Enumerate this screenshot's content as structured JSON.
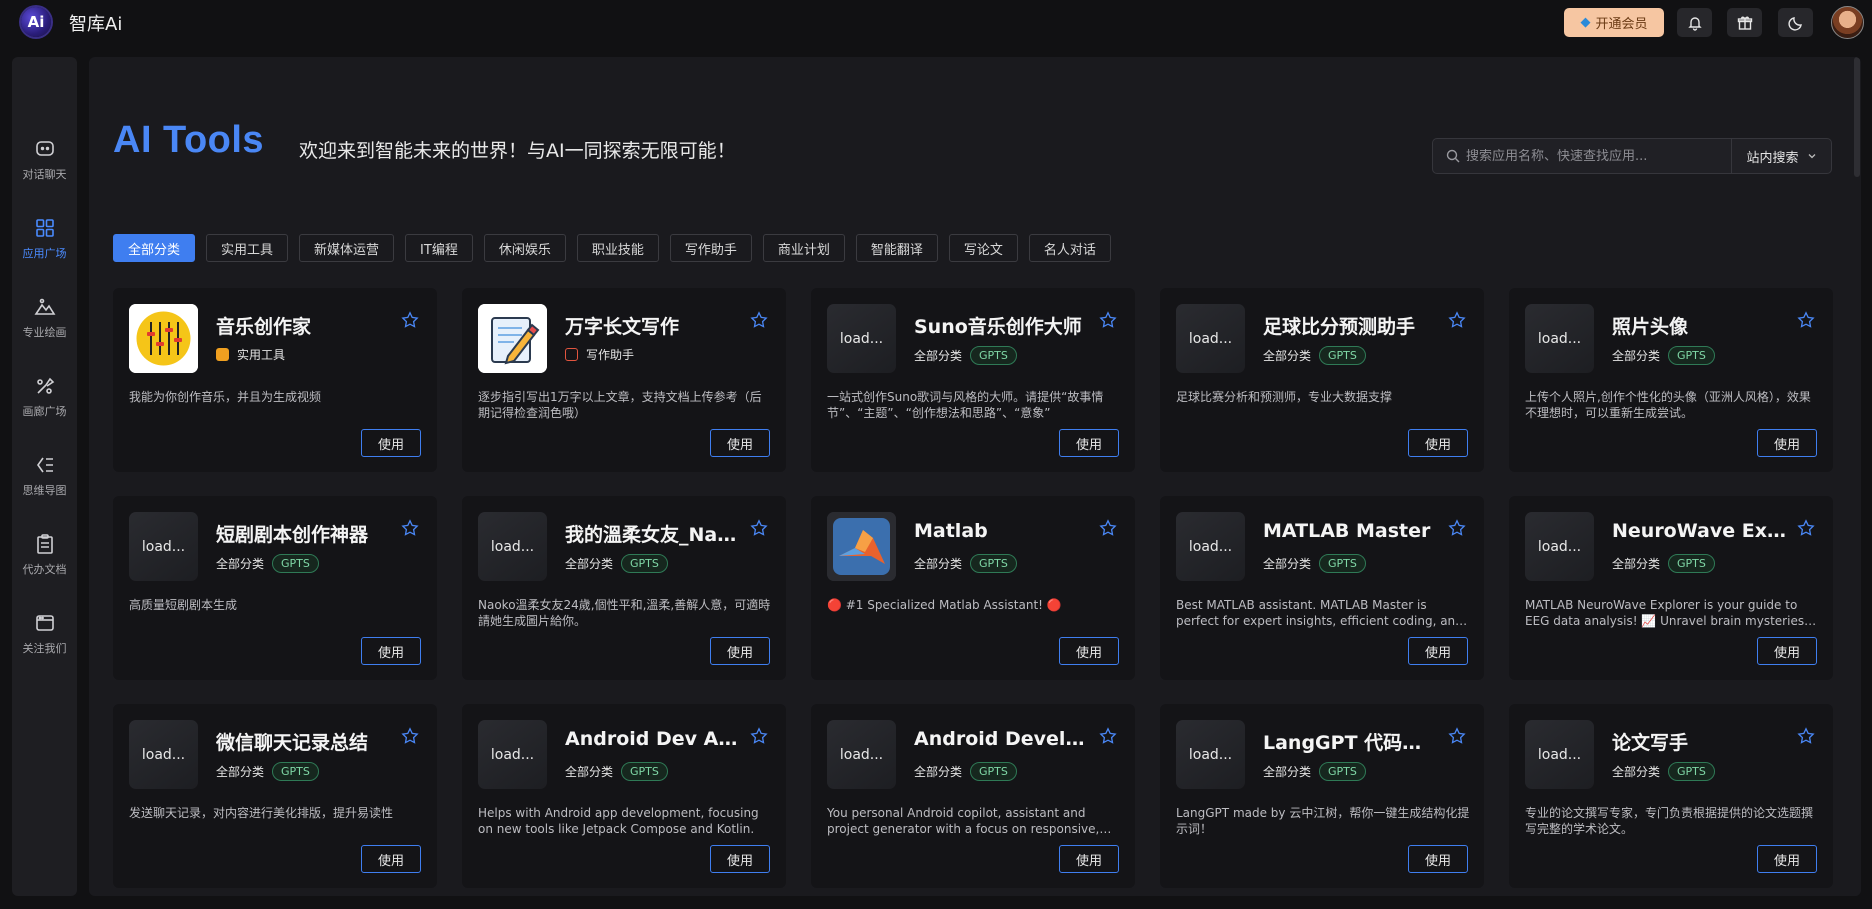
{
  "header": {
    "logo_text": "Ai",
    "app_title": "智库Ai",
    "vip_label": "开通会员",
    "icons": [
      "bell-icon",
      "gift-icon",
      "moon-icon"
    ]
  },
  "sidebar": {
    "items": [
      {
        "label": "对话聊天",
        "icon": "chat-icon",
        "active": false
      },
      {
        "label": "应用广场",
        "icon": "grid-icon",
        "active": true
      },
      {
        "label": "专业绘画",
        "icon": "mountain-icon",
        "active": false
      },
      {
        "label": "画廊广场",
        "icon": "palette-icon",
        "active": false
      },
      {
        "label": "思维导图",
        "icon": "mindmap-icon",
        "active": false
      },
      {
        "label": "代办文档",
        "icon": "clipboard-icon",
        "active": false
      },
      {
        "label": "关注我们",
        "icon": "browser-icon",
        "active": false
      }
    ]
  },
  "hero": {
    "title": "AI Tools",
    "subtitle": "欢迎来到智能未来的世界！与AI一同探索无限可能！"
  },
  "search": {
    "placeholder": "搜索应用名称、快速查找应用...",
    "scope_label": "站内搜索"
  },
  "categories": [
    "全部分类",
    "实用工具",
    "新媒体运营",
    "IT编程",
    "休闲娱乐",
    "职业技能",
    "写作助手",
    "商业计划",
    "智能翻译",
    "写论文",
    "名人对话"
  ],
  "active_category": "全部分类",
  "use_label": "使用",
  "cards": [
    {
      "name": "音乐创作家",
      "category": "实用工具",
      "tag": "",
      "icon": "music-mixer-icon",
      "icon_text": "",
      "desc": "我能为你创作音乐，并且为生成视频"
    },
    {
      "name": "万字长文写作",
      "category": "写作助手",
      "tag": "",
      "icon": "pencil-paper-icon",
      "icon_text": "",
      "desc": "逐步指引写出1万字以上文章，支持文档上传参考（后期记得检查润色哦）"
    },
    {
      "name": "Suno音乐创作大师",
      "category": "全部分类",
      "tag": "GPTS",
      "icon": "placeholder-icon",
      "icon_text": "load...",
      "desc": "一站式创作Suno歌词与风格的大师。请提供“故事情节”、“主题”、“创作想法和思路”、“意象”"
    },
    {
      "name": "足球比分预测助手",
      "category": "全部分类",
      "tag": "GPTS",
      "icon": "placeholder-icon",
      "icon_text": "load...",
      "desc": "足球比赛分析和预测师，专业大数据支撑"
    },
    {
      "name": "照片头像",
      "category": "全部分类",
      "tag": "GPTS",
      "icon": "placeholder-icon",
      "icon_text": "load...",
      "desc": "上传个人照片,创作个性化的头像（亚洲人风格），效果不理想时，可以重新生成尝试。"
    },
    {
      "name": "短剧剧本创作神器",
      "category": "全部分类",
      "tag": "GPTS",
      "icon": "placeholder-icon",
      "icon_text": "load...",
      "desc": "高质量短剧剧本生成"
    },
    {
      "name": "我的溫柔女友_Naoko",
      "category": "全部分类",
      "tag": "GPTS",
      "icon": "placeholder-icon",
      "icon_text": "load...",
      "desc": "Naoko溫柔女友24歲,個性平和,溫柔,善解人意，可適時請她生成圖片給你。"
    },
    {
      "name": "Matlab",
      "category": "全部分类",
      "tag": "GPTS",
      "icon": "matlab-logo-icon",
      "icon_text": "",
      "desc": "🔴 #1 Specialized Matlab Assistant! 🔴"
    },
    {
      "name": "MATLAB Master",
      "category": "全部分类",
      "tag": "GPTS",
      "icon": "placeholder-icon",
      "icon_text": "load...",
      "desc": "Best MATLAB assistant. MATLAB Master is perfect for expert insights, efficient coding, and robust s..."
    },
    {
      "name": "NeuroWave Explorer",
      "category": "全部分类",
      "tag": "GPTS",
      "icon": "placeholder-icon",
      "icon_text": "load...",
      "desc": "MATLAB NeuroWave Explorer is your guide to EEG data analysis! 📈 Unravel brain mysteries with..."
    },
    {
      "name": "微信聊天记录总结",
      "category": "全部分类",
      "tag": "GPTS",
      "icon": "placeholder-icon",
      "icon_text": "load...",
      "desc": "发送聊天记录，对内容进行美化排版，提升易读性"
    },
    {
      "name": "Android Dev Assist",
      "category": "全部分类",
      "tag": "GPTS",
      "icon": "placeholder-icon",
      "icon_text": "load...",
      "desc": "Helps with Android app development, focusing on new tools like Jetpack Compose and Kotlin."
    },
    {
      "name": "Android Developer",
      "category": "全部分类",
      "tag": "GPTS",
      "icon": "placeholder-icon",
      "icon_text": "load...",
      "desc": "You personal Android copilot, assistant and project generator with a focus on responsive, beautiful..."
    },
    {
      "name": "LangGPT 代码诗人",
      "category": "全部分类",
      "tag": "GPTS",
      "icon": "placeholder-icon",
      "icon_text": "load...",
      "desc": "LangGPT made by 云中江树，帮你一键生成结构化提示词！"
    },
    {
      "name": "论文写手",
      "category": "全部分类",
      "tag": "GPTS",
      "icon": "placeholder-icon",
      "icon_text": "load...",
      "desc": "专业的论文撰写专家，专门负责根据提供的论文选题撰写完整的学术论文。"
    }
  ],
  "colors": {
    "accent": "#3f7ef0",
    "title_blue": "#4a87f5",
    "vip_bg": "#f6c6a2",
    "gpts_green": "#7fd7a6",
    "card_bg": "#141417",
    "panel_bg": "#1a1a1e"
  }
}
